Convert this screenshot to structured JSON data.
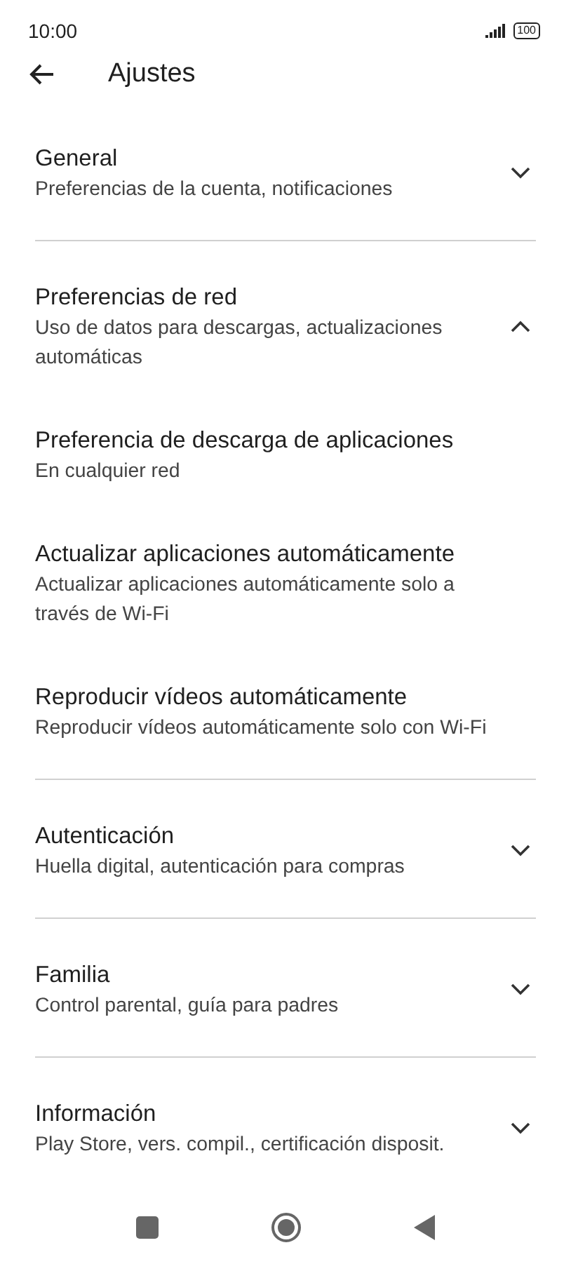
{
  "status_bar": {
    "time": "10:00",
    "battery": "100"
  },
  "header": {
    "title": "Ajustes"
  },
  "sections": [
    {
      "title": "General",
      "subtitle": "Preferencias de la cuenta, notificaciones",
      "expanded": false
    },
    {
      "title": "Preferencias de red",
      "subtitle": "Uso de datos para descargas, actualizaciones automáticas",
      "expanded": true,
      "children": [
        {
          "title": "Preferencia de descarga de aplicaciones",
          "subtitle": "En cualquier red"
        },
        {
          "title": "Actualizar aplicaciones automáticamente",
          "subtitle": "Actualizar aplicaciones automáticamente solo a través de Wi-Fi"
        },
        {
          "title": "Reproducir vídeos automáticamente",
          "subtitle": "Reproducir vídeos automáticamente solo con Wi-Fi"
        }
      ]
    },
    {
      "title": "Autenticación",
      "subtitle": "Huella digital, autenticación para compras",
      "expanded": false
    },
    {
      "title": "Familia",
      "subtitle": "Control parental, guía para padres",
      "expanded": false
    },
    {
      "title": "Información",
      "subtitle": "Play Store, vers. compil., certificación disposit.",
      "expanded": false
    }
  ]
}
